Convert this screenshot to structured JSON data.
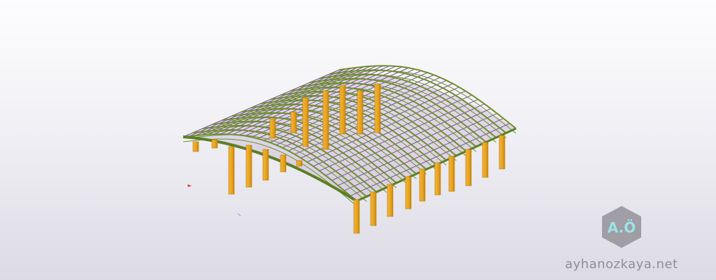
{
  "viewer": {
    "background_top": "#fdfdfe",
    "background_bottom": "#dcdbe4"
  },
  "model": {
    "description_colors": {
      "roof_purlins": "#7a4f9a",
      "roof_arches": "#6f8f2e",
      "columns": "#e8a21c"
    }
  },
  "logo": {
    "text": "A.Ö",
    "badge_color": "#9e9ea4",
    "text_color": "#9fe3e6"
  },
  "watermark": {
    "text": "ayhanozkaya.net"
  }
}
